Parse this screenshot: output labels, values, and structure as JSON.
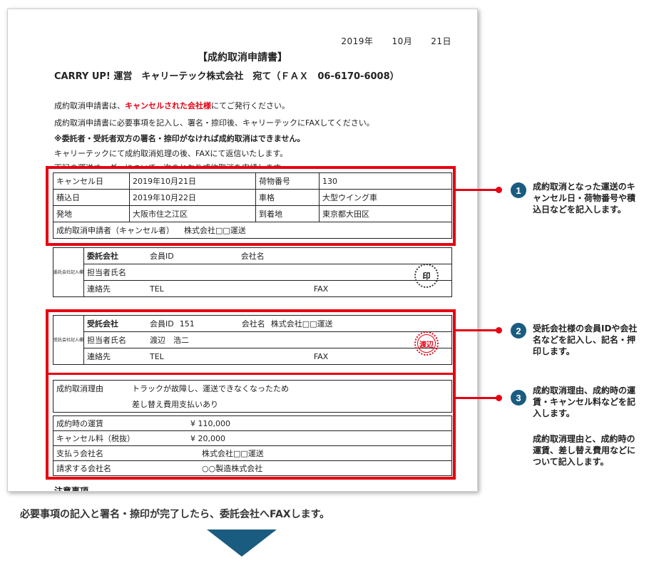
{
  "form": {
    "date": {
      "year": "2019年",
      "month": "10月",
      "day": "21日"
    },
    "title": "【成約取消申請書】",
    "to": "CARRY UP! 運営　キャリーテック株式会社　宛て（ＦＡＸ　06-6170-6008）",
    "p1_pre": "成約取消申請書は、",
    "p1_red": "キャンセルされた会社様",
    "p1_post": "にてご発行ください。",
    "p2": "成約取消申請書に必要事項を記入し、署名・捺印後、キャリーテックにFAXしてください。",
    "p3": "※委託者・受託者双方の署名・捺印がなければ成約取消はできません。",
    "p4": "キャリーテックにて成約取消処理の後、FAXにて返信いたします。",
    "p5": "下記の運送オーダーについて、次のとおり成約取消を申請します。",
    "cancel": {
      "cancel_date_label": "キャンセル日",
      "cancel_date": "2019年10月21日",
      "cargo_no_label": "荷物番号",
      "cargo_no": "130",
      "load_date_label": "積込日",
      "load_date": "2019年10月22日",
      "truck_label": "車格",
      "truck": "大型ウイング車",
      "origin_label": "発地",
      "origin": "大阪市住之江区",
      "dest_label": "到着地",
      "dest": "東京都大田区",
      "applicant_label": "成約取消申請者（キャンセル者）",
      "applicant": "株式会社□□運送"
    },
    "consignor": {
      "side": "委託会社記入欄",
      "name": "委託会社",
      "member_id_label": "会員ID",
      "member_id": "",
      "company_label": "会社名",
      "company": "",
      "person_label": "担当者氏名",
      "person": "",
      "seal": "印",
      "contact_label": "連絡先",
      "tel_label": "TEL",
      "fax_label": "FAX"
    },
    "consignee": {
      "side": "受託会社記入欄",
      "name": "受託会社",
      "member_id_label": "会員ID",
      "member_id": "151",
      "company_label": "会社名",
      "company": "株式会社□□運送",
      "person_label": "担当者氏名",
      "person": "渡辺　浩二",
      "seal": "渡辺",
      "contact_label": "連絡先",
      "tel_label": "TEL",
      "fax_label": "FAX"
    },
    "reason": {
      "label": "成約取消理由",
      "line1": "トラックが故障し、運送できなくなったため",
      "line2": "差し替え費用支払いあり"
    },
    "fees": {
      "fare_label": "成約時の運賃",
      "fare": "¥ 110,000",
      "cancel_fee_label": "キャンセル料（税抜）",
      "cancel_fee": "¥ 20,000",
      "payer_label": "支払う会社名",
      "payer": "株式会社□□運送",
      "billing_label": "請求する会社名",
      "billing": "○○製造株式会社"
    },
    "notes_heading": "注意事項"
  },
  "callouts": [
    {
      "num": "1",
      "text": "成約取消となった運送のキャンセル日・荷物番号や積込日などを記入します。"
    },
    {
      "num": "2",
      "text": "受託会社様の会員IDや会社名などを記入し、記名・押印します。"
    },
    {
      "num": "3",
      "text": "成約取消理由、成約時の運賃・キャンセル料などを記入します。",
      "text2": "成約取消理由と、成約時の運賃、差し替え費用などについて記入します。"
    }
  ],
  "footer": "必要事項の記入と署名・捺印が完了したら、委託会社へFAXします。",
  "colors": {
    "accent": "#e60012",
    "badge": "#1a5c80"
  }
}
